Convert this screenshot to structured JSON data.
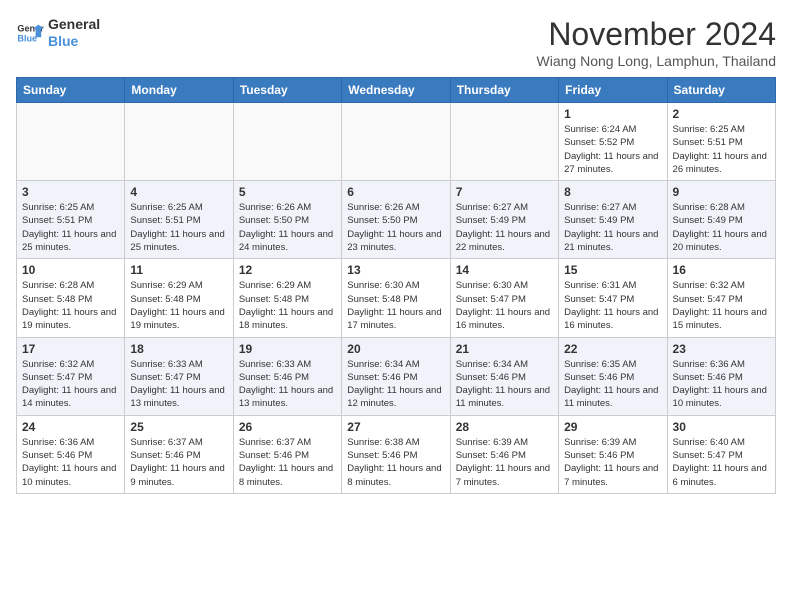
{
  "header": {
    "logo_line1": "General",
    "logo_line2": "Blue",
    "month": "November 2024",
    "location": "Wiang Nong Long, Lamphun, Thailand"
  },
  "days_of_week": [
    "Sunday",
    "Monday",
    "Tuesday",
    "Wednesday",
    "Thursday",
    "Friday",
    "Saturday"
  ],
  "weeks": [
    {
      "days": [
        {
          "num": "",
          "empty": true
        },
        {
          "num": "",
          "empty": true
        },
        {
          "num": "",
          "empty": true
        },
        {
          "num": "",
          "empty": true
        },
        {
          "num": "",
          "empty": true
        },
        {
          "num": "1",
          "sunrise": "6:24 AM",
          "sunset": "5:52 PM",
          "daylight": "11 hours and 27 minutes."
        },
        {
          "num": "2",
          "sunrise": "6:25 AM",
          "sunset": "5:51 PM",
          "daylight": "11 hours and 26 minutes."
        }
      ]
    },
    {
      "days": [
        {
          "num": "3",
          "sunrise": "6:25 AM",
          "sunset": "5:51 PM",
          "daylight": "11 hours and 25 minutes."
        },
        {
          "num": "4",
          "sunrise": "6:25 AM",
          "sunset": "5:51 PM",
          "daylight": "11 hours and 25 minutes."
        },
        {
          "num": "5",
          "sunrise": "6:26 AM",
          "sunset": "5:50 PM",
          "daylight": "11 hours and 24 minutes."
        },
        {
          "num": "6",
          "sunrise": "6:26 AM",
          "sunset": "5:50 PM",
          "daylight": "11 hours and 23 minutes."
        },
        {
          "num": "7",
          "sunrise": "6:27 AM",
          "sunset": "5:49 PM",
          "daylight": "11 hours and 22 minutes."
        },
        {
          "num": "8",
          "sunrise": "6:27 AM",
          "sunset": "5:49 PM",
          "daylight": "11 hours and 21 minutes."
        },
        {
          "num": "9",
          "sunrise": "6:28 AM",
          "sunset": "5:49 PM",
          "daylight": "11 hours and 20 minutes."
        }
      ]
    },
    {
      "days": [
        {
          "num": "10",
          "sunrise": "6:28 AM",
          "sunset": "5:48 PM",
          "daylight": "11 hours and 19 minutes."
        },
        {
          "num": "11",
          "sunrise": "6:29 AM",
          "sunset": "5:48 PM",
          "daylight": "11 hours and 19 minutes."
        },
        {
          "num": "12",
          "sunrise": "6:29 AM",
          "sunset": "5:48 PM",
          "daylight": "11 hours and 18 minutes."
        },
        {
          "num": "13",
          "sunrise": "6:30 AM",
          "sunset": "5:48 PM",
          "daylight": "11 hours and 17 minutes."
        },
        {
          "num": "14",
          "sunrise": "6:30 AM",
          "sunset": "5:47 PM",
          "daylight": "11 hours and 16 minutes."
        },
        {
          "num": "15",
          "sunrise": "6:31 AM",
          "sunset": "5:47 PM",
          "daylight": "11 hours and 16 minutes."
        },
        {
          "num": "16",
          "sunrise": "6:32 AM",
          "sunset": "5:47 PM",
          "daylight": "11 hours and 15 minutes."
        }
      ]
    },
    {
      "days": [
        {
          "num": "17",
          "sunrise": "6:32 AM",
          "sunset": "5:47 PM",
          "daylight": "11 hours and 14 minutes."
        },
        {
          "num": "18",
          "sunrise": "6:33 AM",
          "sunset": "5:47 PM",
          "daylight": "11 hours and 13 minutes."
        },
        {
          "num": "19",
          "sunrise": "6:33 AM",
          "sunset": "5:46 PM",
          "daylight": "11 hours and 13 minutes."
        },
        {
          "num": "20",
          "sunrise": "6:34 AM",
          "sunset": "5:46 PM",
          "daylight": "11 hours and 12 minutes."
        },
        {
          "num": "21",
          "sunrise": "6:34 AM",
          "sunset": "5:46 PM",
          "daylight": "11 hours and 11 minutes."
        },
        {
          "num": "22",
          "sunrise": "6:35 AM",
          "sunset": "5:46 PM",
          "daylight": "11 hours and 11 minutes."
        },
        {
          "num": "23",
          "sunrise": "6:36 AM",
          "sunset": "5:46 PM",
          "daylight": "11 hours and 10 minutes."
        }
      ]
    },
    {
      "days": [
        {
          "num": "24",
          "sunrise": "6:36 AM",
          "sunset": "5:46 PM",
          "daylight": "11 hours and 10 minutes."
        },
        {
          "num": "25",
          "sunrise": "6:37 AM",
          "sunset": "5:46 PM",
          "daylight": "11 hours and 9 minutes."
        },
        {
          "num": "26",
          "sunrise": "6:37 AM",
          "sunset": "5:46 PM",
          "daylight": "11 hours and 8 minutes."
        },
        {
          "num": "27",
          "sunrise": "6:38 AM",
          "sunset": "5:46 PM",
          "daylight": "11 hours and 8 minutes."
        },
        {
          "num": "28",
          "sunrise": "6:39 AM",
          "sunset": "5:46 PM",
          "daylight": "11 hours and 7 minutes."
        },
        {
          "num": "29",
          "sunrise": "6:39 AM",
          "sunset": "5:46 PM",
          "daylight": "11 hours and 7 minutes."
        },
        {
          "num": "30",
          "sunrise": "6:40 AM",
          "sunset": "5:47 PM",
          "daylight": "11 hours and 6 minutes."
        }
      ]
    }
  ]
}
